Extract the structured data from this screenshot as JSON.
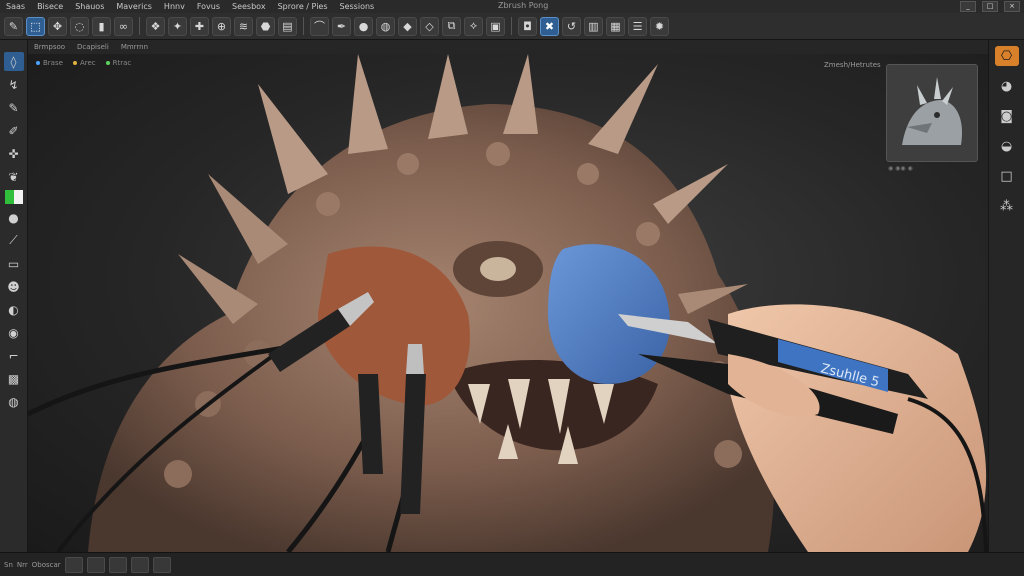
{
  "app": {
    "title": "Zbrush Pong"
  },
  "menu": {
    "items": [
      "Saas",
      "Bisece",
      "Shauos",
      "Maverics",
      "Hnnv",
      "Fovus",
      "Seesbox",
      "Sprore / Pies",
      "Sessions"
    ],
    "window_controls": [
      "min",
      "max",
      "close"
    ]
  },
  "toolbar": {
    "tools": [
      {
        "name": "brush-icon",
        "glyph": "✎"
      },
      {
        "name": "select-rect-icon",
        "glyph": "⬚",
        "active": true
      },
      {
        "name": "move-icon",
        "glyph": "✥"
      },
      {
        "name": "lasso-icon",
        "glyph": "◌"
      },
      {
        "name": "channel-icon",
        "glyph": "▮"
      },
      {
        "name": "link-icon",
        "glyph": "∞"
      },
      {
        "name": "paint-icon",
        "glyph": "❖"
      },
      {
        "name": "star-icon",
        "glyph": "✦"
      },
      {
        "name": "sculpt-icon",
        "glyph": "✚"
      },
      {
        "name": "gizmo-icon",
        "glyph": "⊕"
      },
      {
        "name": "smooth-icon",
        "glyph": "≋"
      },
      {
        "name": "clay-icon",
        "glyph": "⬣"
      },
      {
        "name": "document-icon",
        "glyph": "▤"
      },
      {
        "name": "curve-icon",
        "glyph": "⌒"
      },
      {
        "name": "pen-icon",
        "glyph": "✒"
      },
      {
        "name": "material-icon",
        "glyph": "●"
      },
      {
        "name": "color-icon",
        "glyph": "◍"
      },
      {
        "name": "texture-icon",
        "glyph": "◆"
      },
      {
        "name": "dynamesh-icon",
        "glyph": "◇"
      },
      {
        "name": "symmetry-icon",
        "glyph": "⧉"
      },
      {
        "name": "transpose-icon",
        "glyph": "⟡"
      },
      {
        "name": "mask-icon",
        "glyph": "▣"
      },
      {
        "name": "polygroup-icon",
        "glyph": "◘"
      },
      {
        "name": "cross-icon",
        "glyph": "✖",
        "active": true
      },
      {
        "name": "undo-icon",
        "glyph": "↺"
      },
      {
        "name": "layers-icon",
        "glyph": "▥"
      },
      {
        "name": "grid-icon",
        "glyph": "▦"
      },
      {
        "name": "list-icon",
        "glyph": "☰"
      },
      {
        "name": "gear-icon",
        "glyph": "✹"
      }
    ]
  },
  "subbar": {
    "items": [
      "Brmpsoo",
      "Dcapiseli",
      "Mmrrnn"
    ]
  },
  "viewport": {
    "legend": [
      {
        "label": "Brase",
        "color": "#4aa3ff"
      },
      {
        "label": "Arec",
        "color": "#e0b040"
      },
      {
        "label": "Rtrac",
        "color": "#5fd35f"
      }
    ],
    "label": "Zmesh/Hetrutes",
    "thumb_caption": "◉ ◉◉ ◉"
  },
  "left_tools": [
    {
      "name": "standard-brush-icon",
      "glyph": "◊",
      "active": true
    },
    {
      "name": "move-brush-icon",
      "glyph": "↯"
    },
    {
      "name": "clay-brush-icon",
      "glyph": "✎"
    },
    {
      "name": "pinch-brush-icon",
      "glyph": "✐"
    },
    {
      "name": "inflate-brush-icon",
      "glyph": "✜"
    },
    {
      "name": "layer-brush-icon",
      "glyph": "❦"
    },
    {
      "name": "color-swatch-icon",
      "glyph": ""
    },
    {
      "name": "sphere-icon",
      "glyph": "●"
    },
    {
      "name": "knife-icon",
      "glyph": "⟋"
    },
    {
      "name": "frame-icon",
      "glyph": "▭"
    },
    {
      "name": "head-icon",
      "glyph": "☻"
    },
    {
      "name": "spiral-icon",
      "glyph": "◐"
    },
    {
      "name": "globe-icon",
      "glyph": "◉"
    },
    {
      "name": "chevron-icon",
      "glyph": "⌐"
    },
    {
      "name": "picture-icon",
      "glyph": "▩"
    },
    {
      "name": "rotate-icon",
      "glyph": "◍"
    }
  ],
  "right_tools": [
    {
      "name": "active-tool-icon",
      "glyph": "⎔",
      "active": true
    },
    {
      "name": "visibility-icon",
      "glyph": "◕"
    },
    {
      "name": "camera-icon",
      "glyph": "◙"
    },
    {
      "name": "light-icon",
      "glyph": "◒"
    },
    {
      "name": "canvas-icon",
      "glyph": "□"
    },
    {
      "name": "cluster-icon",
      "glyph": "⁂"
    }
  ],
  "bottombar": {
    "items": [
      "Sn",
      "Nrr",
      "Oboscar"
    ]
  },
  "colors": {
    "accent_blue": "#2f5f92",
    "accent_orange": "#d9802b",
    "sculpt_skin": "#8a6a58",
    "clay_blue": "#4f7fc4",
    "skin_tone": "#e8b99a"
  }
}
